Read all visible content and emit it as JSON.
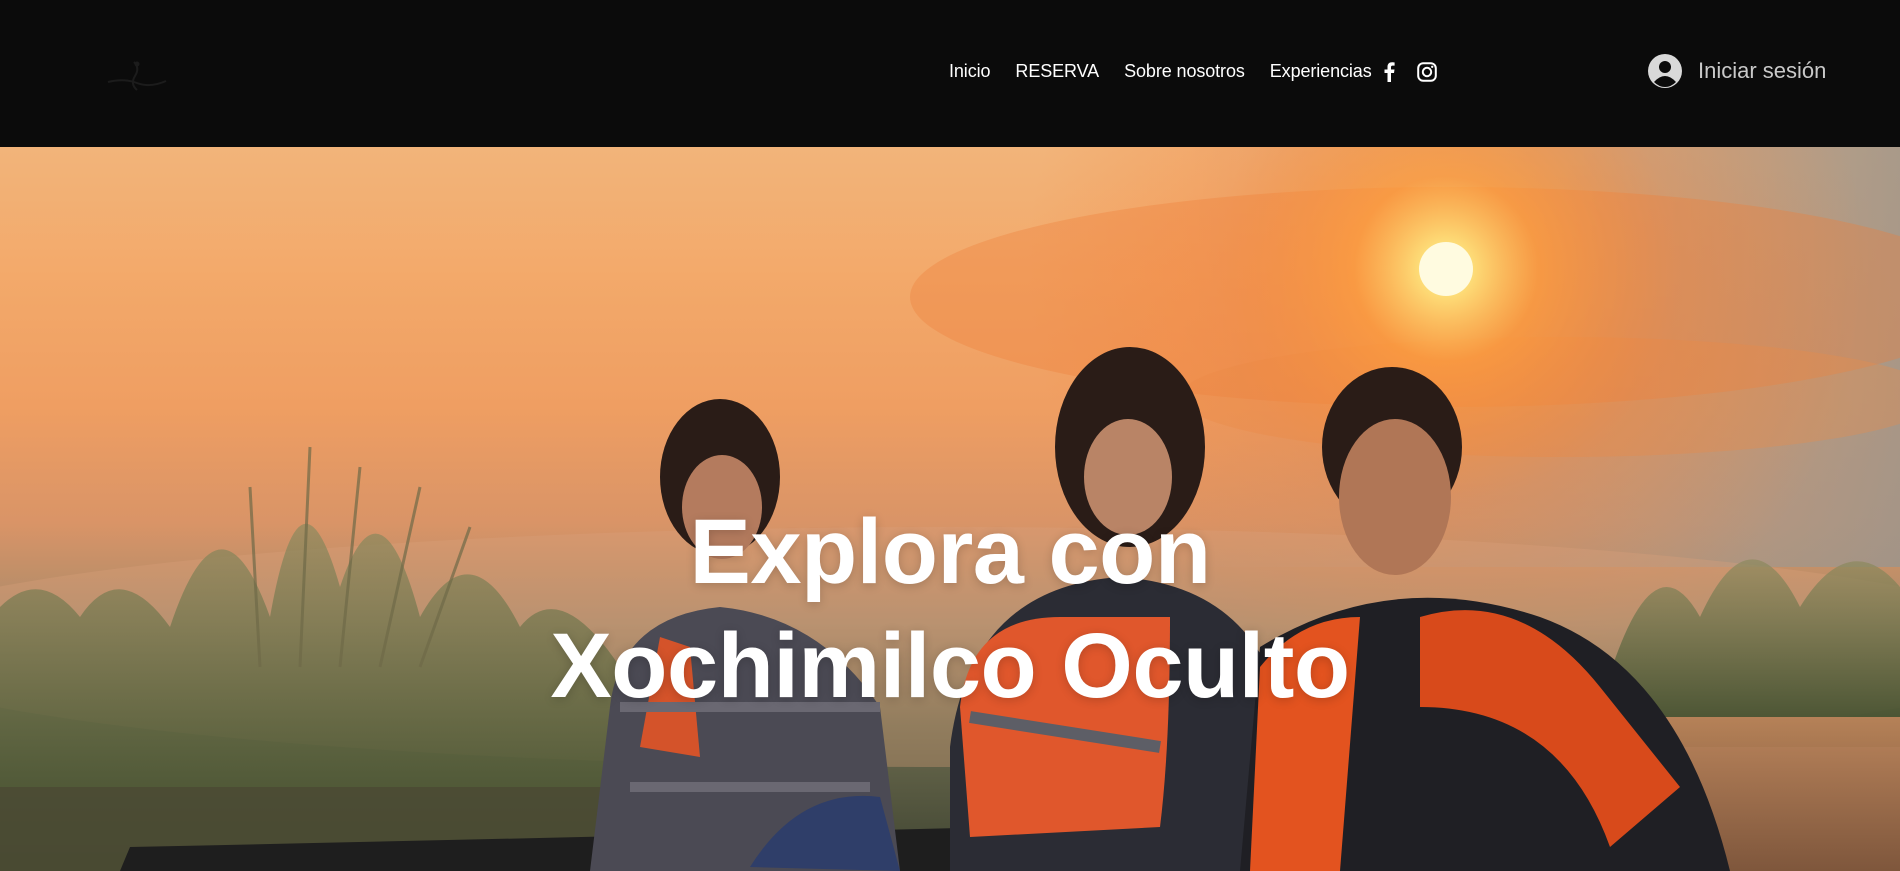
{
  "header": {
    "nav": [
      {
        "label": "Inicio"
      },
      {
        "label": "RESERVA"
      },
      {
        "label": "Sobre nosotros"
      },
      {
        "label": "Experiencias"
      }
    ],
    "social": [
      {
        "icon": "facebook-icon"
      },
      {
        "icon": "instagram-icon"
      }
    ],
    "login": {
      "label": "Iniciar sesión",
      "icon": "user-avatar-icon"
    }
  },
  "hero": {
    "title_line1": "Explora con",
    "title_line2": "Xochimilco Oculto"
  },
  "colors": {
    "header_bg": "#0b0b0b",
    "nav_text": "#ffffff",
    "login_text": "#c9c9c9",
    "sky_top": "#f2b47a",
    "sun": "#fff6c8"
  }
}
